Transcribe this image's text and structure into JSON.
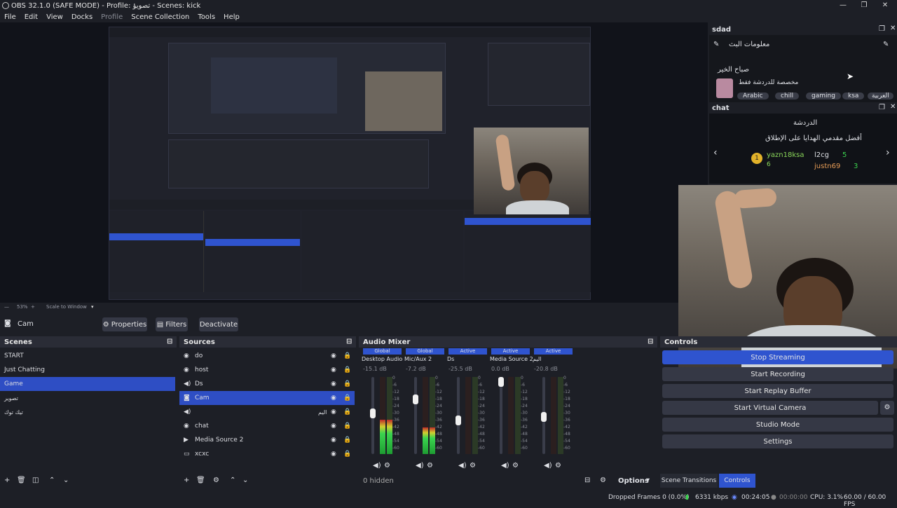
{
  "window": {
    "title": "OBS 32.1.0 (SAFE MODE) - Profile: تصويؤ - Scenes: kick",
    "minimize": "—",
    "maximize": "❐",
    "close": "✕"
  },
  "menu": [
    "File",
    "Edit",
    "View",
    "Docks",
    "Profile",
    "Scene Collection",
    "Tools",
    "Help"
  ],
  "preview_bar": {
    "zoom": "53%",
    "scale": "Scale to Window"
  },
  "source_toolbar": {
    "source": "Cam",
    "properties": "Properties",
    "filters": "Filters",
    "deactivate": "Deactivate"
  },
  "scenes": {
    "title": "Scenes",
    "items": [
      "START",
      "Just Chatting",
      "Game",
      "تصوير",
      "تيك توك"
    ],
    "selected": 2
  },
  "sources": {
    "title": "Sources",
    "items": [
      {
        "name": "do",
        "icon": "globe-icon"
      },
      {
        "name": "host",
        "icon": "globe-icon"
      },
      {
        "name": "Ds",
        "icon": "speaker-icon"
      },
      {
        "name": "Cam",
        "icon": "camera-icon"
      },
      {
        "name": "",
        "icon": "speaker-icon",
        "rtl": "اليم"
      },
      {
        "name": "chat",
        "icon": "globe-icon"
      },
      {
        "name": "Media Source 2",
        "icon": "play-icon"
      },
      {
        "name": "xcxc",
        "icon": "window-icon"
      }
    ],
    "selected": 3
  },
  "audio": {
    "title": "Audio Mixer",
    "hidden_label": "0 hidden",
    "options_label": "Options",
    "channels": [
      {
        "badge": "Global",
        "name": "Desktop Audio",
        "db": "-15.1 dB",
        "level": 0.45,
        "fader": 0.55
      },
      {
        "badge": "Global",
        "name": "Mic/Aux 2",
        "db": "-7.2 dB",
        "level": 0.35,
        "fader": 0.75
      },
      {
        "badge": "Active",
        "name": "Ds",
        "db": "-25.5 dB",
        "level": 0.0,
        "fader": 0.45
      },
      {
        "badge": "Active",
        "name": "Media Source 2",
        "db": "0.0 dB",
        "level": 0.0,
        "fader": 1.0
      },
      {
        "badge": "Active",
        "name": "اليم",
        "db": "-20.8 dB",
        "level": 0.0,
        "fader": 0.5
      }
    ],
    "ticks": [
      "0",
      "-6",
      "-12",
      "-18",
      "-24",
      "-30",
      "-36",
      "-42",
      "-48",
      "-54",
      "-60"
    ]
  },
  "controls": {
    "title": "Controls",
    "stop_streaming": "Stop Streaming",
    "start_recording": "Start Recording",
    "start_replay": "Start Replay Buffer",
    "start_vcam": "Start Virtual Camera",
    "studio_mode": "Studio Mode",
    "settings": "Settings",
    "tab_transitions": "Scene Transitions",
    "tab_controls": "Controls"
  },
  "dock_sdad": {
    "title": "sdad",
    "heading": "معلومات البث",
    "greeting": "صباح الخير",
    "subtitle": "مخصصة للدردشة فقط",
    "tags": [
      "Arabic",
      "chill",
      "gaming",
      "ksa",
      "العربية"
    ]
  },
  "dock_chat": {
    "title": "chat",
    "heading": "الدردشة",
    "subheading": "أفضل مقدمي الهدايا على الإطلاق",
    "rank_badge": "1",
    "gifters": [
      {
        "name": "yazn18ksa",
        "count": "6"
      },
      {
        "name": "l2cg",
        "count": "5"
      },
      {
        "name": "justn69",
        "count": "3"
      }
    ]
  },
  "status": {
    "dropped": "Dropped Frames 0 (0.0%)",
    "kbps": "6331 kbps",
    "stream_time": "00:24:05",
    "rec_time": "00:00:00",
    "cpu": "CPU: 3.1%",
    "fps": "60.00 / 60.00 FPS"
  },
  "colors": {
    "accent": "#2f54cf",
    "live_green": "#3bd44f",
    "bg": "#1d1f26"
  }
}
